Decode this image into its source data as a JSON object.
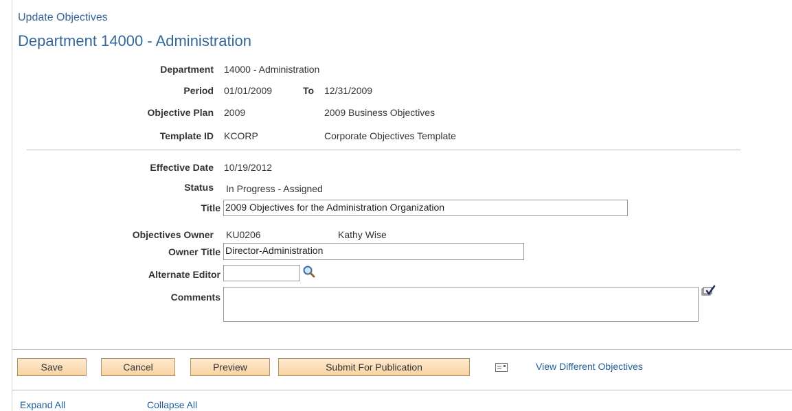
{
  "header": {
    "breadcrumb": "Update Objectives",
    "page_title": "Department 14000 - Administration"
  },
  "info": {
    "department_label": "Department",
    "department_value": "14000 - Administration",
    "period_label": "Period",
    "period_from": "01/01/2009",
    "period_to_label": "To",
    "period_to": "12/31/2009",
    "objective_plan_label": "Objective Plan",
    "objective_plan_value": "2009",
    "objective_plan_desc": "2009 Business Objectives",
    "template_id_label": "Template ID",
    "template_id_value": "KCORP",
    "template_id_desc": "Corporate Objectives Template"
  },
  "details": {
    "effective_date_label": "Effective Date",
    "effective_date_value": "10/19/2012",
    "status_label": "Status",
    "status_value": "In Progress - Assigned",
    "title_label": "Title",
    "title_value": "2009 Objectives for the Administration Organization",
    "owner_label": "Objectives Owner",
    "owner_id": "KU0206",
    "owner_name": "Kathy Wise",
    "owner_title_label": "Owner Title",
    "owner_title_value": "Director-Administration",
    "alternate_editor_label": "Alternate Editor",
    "alternate_editor_value": "",
    "comments_label": "Comments",
    "comments_value": ""
  },
  "actions": {
    "save": "Save",
    "cancel": "Cancel",
    "preview": "Preview",
    "submit": "Submit For Publication",
    "view_different": "View Different Objectives"
  },
  "footer": {
    "expand_all": "Expand All",
    "collapse_all": "Collapse All"
  },
  "icons": {
    "lookup": "magnifier-icon",
    "spellcheck": "spell-check-icon",
    "notify": "notify-icon"
  }
}
